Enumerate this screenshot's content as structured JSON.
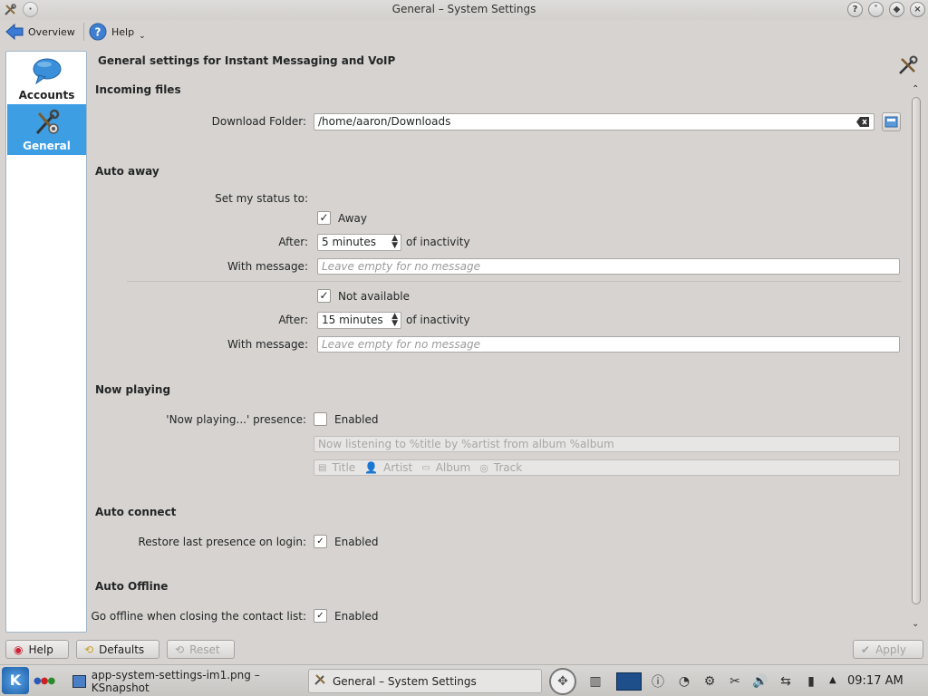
{
  "window": {
    "title": "General – System Settings"
  },
  "toolbar": {
    "overview_label": "Overview",
    "help_label": "Help"
  },
  "sidebar": {
    "items": [
      {
        "label": "Accounts",
        "icon": "chat-bubble-icon",
        "active": false
      },
      {
        "label": "General",
        "icon": "tools-icon",
        "active": true
      }
    ]
  },
  "main": {
    "title": "General settings for Instant Messaging and VoIP",
    "incoming_files": {
      "heading": "Incoming files",
      "download_folder_label": "Download Folder:",
      "download_folder_value": "/home/aaron/Downloads"
    },
    "auto_away": {
      "heading": "Auto away",
      "set_status_label": "Set my status to:",
      "away": {
        "checkbox_label": "Away",
        "checked": true,
        "after_label": "After:",
        "after_value": "5 minutes",
        "inactivity_label": "of inactivity",
        "message_label": "With message:",
        "message_placeholder": "Leave empty for no message"
      },
      "not_available": {
        "checkbox_label": "Not available",
        "checked": true,
        "after_label": "After:",
        "after_value": "15 minutes",
        "inactivity_label": "of inactivity",
        "message_label": "With message:",
        "message_placeholder": "Leave empty for no message"
      }
    },
    "now_playing": {
      "heading": "Now playing",
      "presence_label": "'Now playing...' presence:",
      "enabled_label": "Enabled",
      "checked": false,
      "format_placeholder": "Now listening to %title by %artist from album %album",
      "tags": [
        "Title",
        "Artist",
        "Album",
        "Track"
      ]
    },
    "auto_connect": {
      "heading": "Auto connect",
      "restore_label": "Restore last presence on login:",
      "enabled_label": "Enabled",
      "checked": true
    },
    "auto_offline": {
      "heading": "Auto Offline",
      "offline_label": "Go offline when closing the contact list:",
      "enabled_label": "Enabled",
      "checked": true
    }
  },
  "buttons": {
    "help": "Help",
    "defaults": "Defaults",
    "reset": "Reset",
    "apply": "Apply"
  },
  "taskbar": {
    "tasks": [
      {
        "label": "app-system-settings-im1.png – KSnapshot",
        "active": false
      },
      {
        "label": "General – System Settings",
        "active": true
      }
    ],
    "clock": "09:17 AM"
  },
  "colors": {
    "accent": "#3d9ee4",
    "window_bg": "#d6d3d0"
  }
}
